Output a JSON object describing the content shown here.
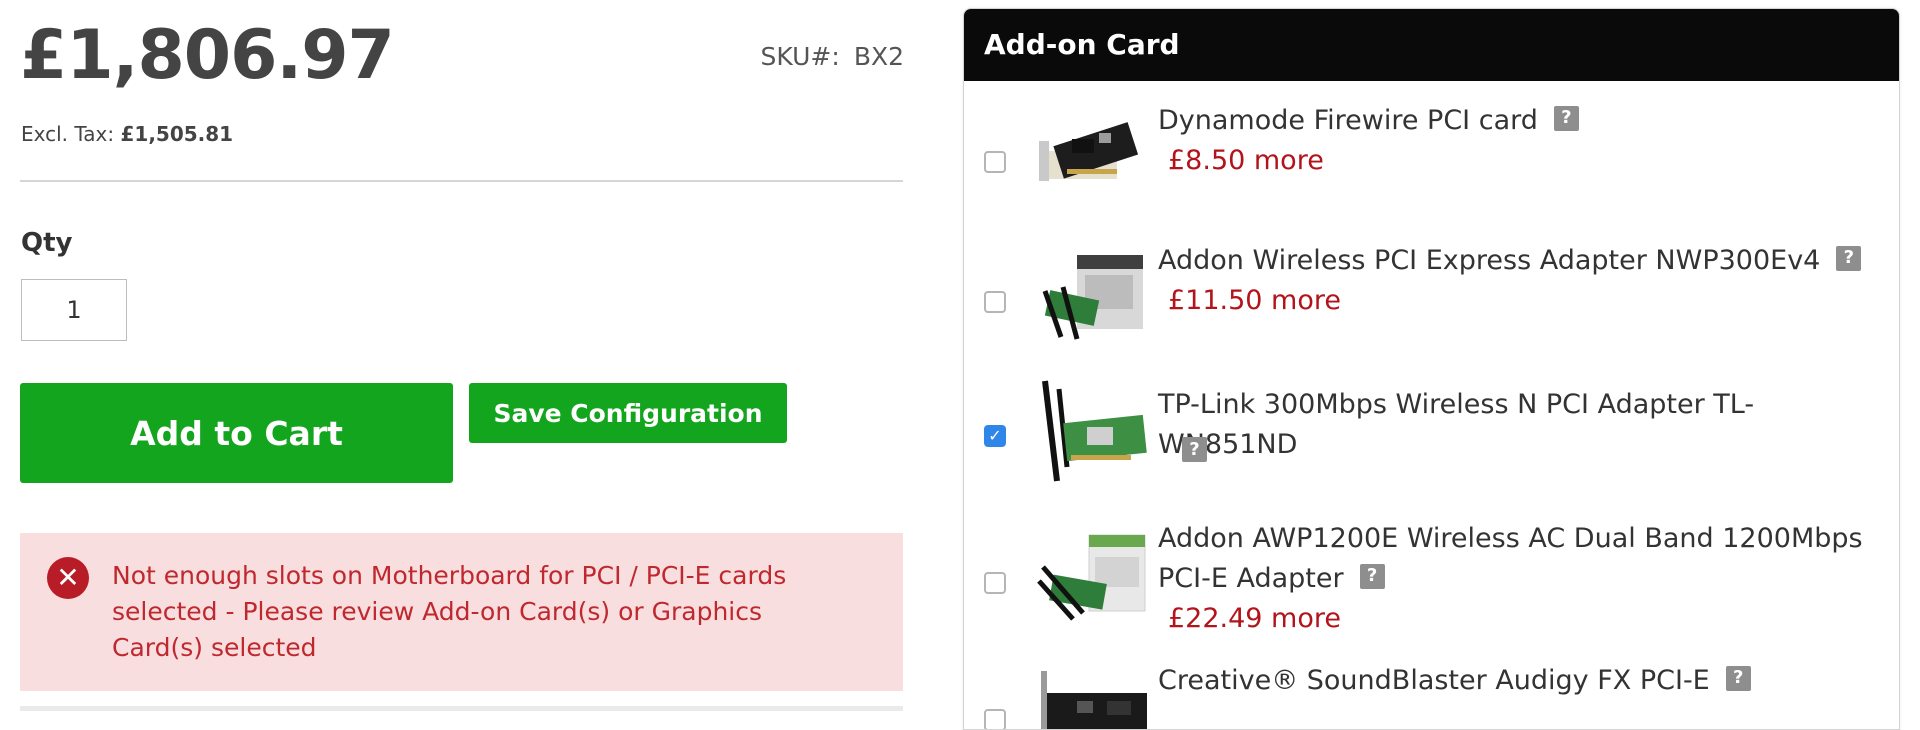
{
  "product": {
    "price": "£1,806.97",
    "excl_tax_label": "Excl. Tax:",
    "excl_tax_value": "£1,505.81",
    "sku_label": "SKU#:",
    "sku_value": "BX2"
  },
  "quantity": {
    "label": "Qty",
    "value": "1"
  },
  "buttons": {
    "add_to_cart": "Add to Cart",
    "save_configuration": "Save Configuration"
  },
  "alert": {
    "icon": "error-x-icon",
    "message": "Not enough slots on Motherboard for PCI / PCI-E cards selected - Please review Add-on Card(s) or Graphics Card(s) selected"
  },
  "addon_panel": {
    "title": "Add-on Card",
    "help_label": "?",
    "options": [
      {
        "name": "Dynamode Firewire PCI card",
        "price": "£8.50 more",
        "checked": false
      },
      {
        "name": "Addon Wireless PCI Express Adapter NWP300Ev4",
        "price": "£11.50 more",
        "checked": false
      },
      {
        "name": "TP-Link 300Mbps Wireless N PCI Adapter TL-WN851ND",
        "price": "",
        "checked": true
      },
      {
        "name": "Addon AWP1200E Wireless AC Dual Band 1200Mbps PCI-E Adapter",
        "price": "£22.49 more",
        "checked": false
      },
      {
        "name": "Creative® SoundBlaster Audigy FX PCI-E",
        "price": "",
        "checked": false
      }
    ]
  },
  "colors": {
    "button_green": "#13a51e",
    "alert_background": "#f8dede",
    "alert_text": "#c0282f",
    "price_more_red": "#b3141b",
    "checkbox_blue": "#2f86e9",
    "panel_header": "#0a0a0a"
  }
}
